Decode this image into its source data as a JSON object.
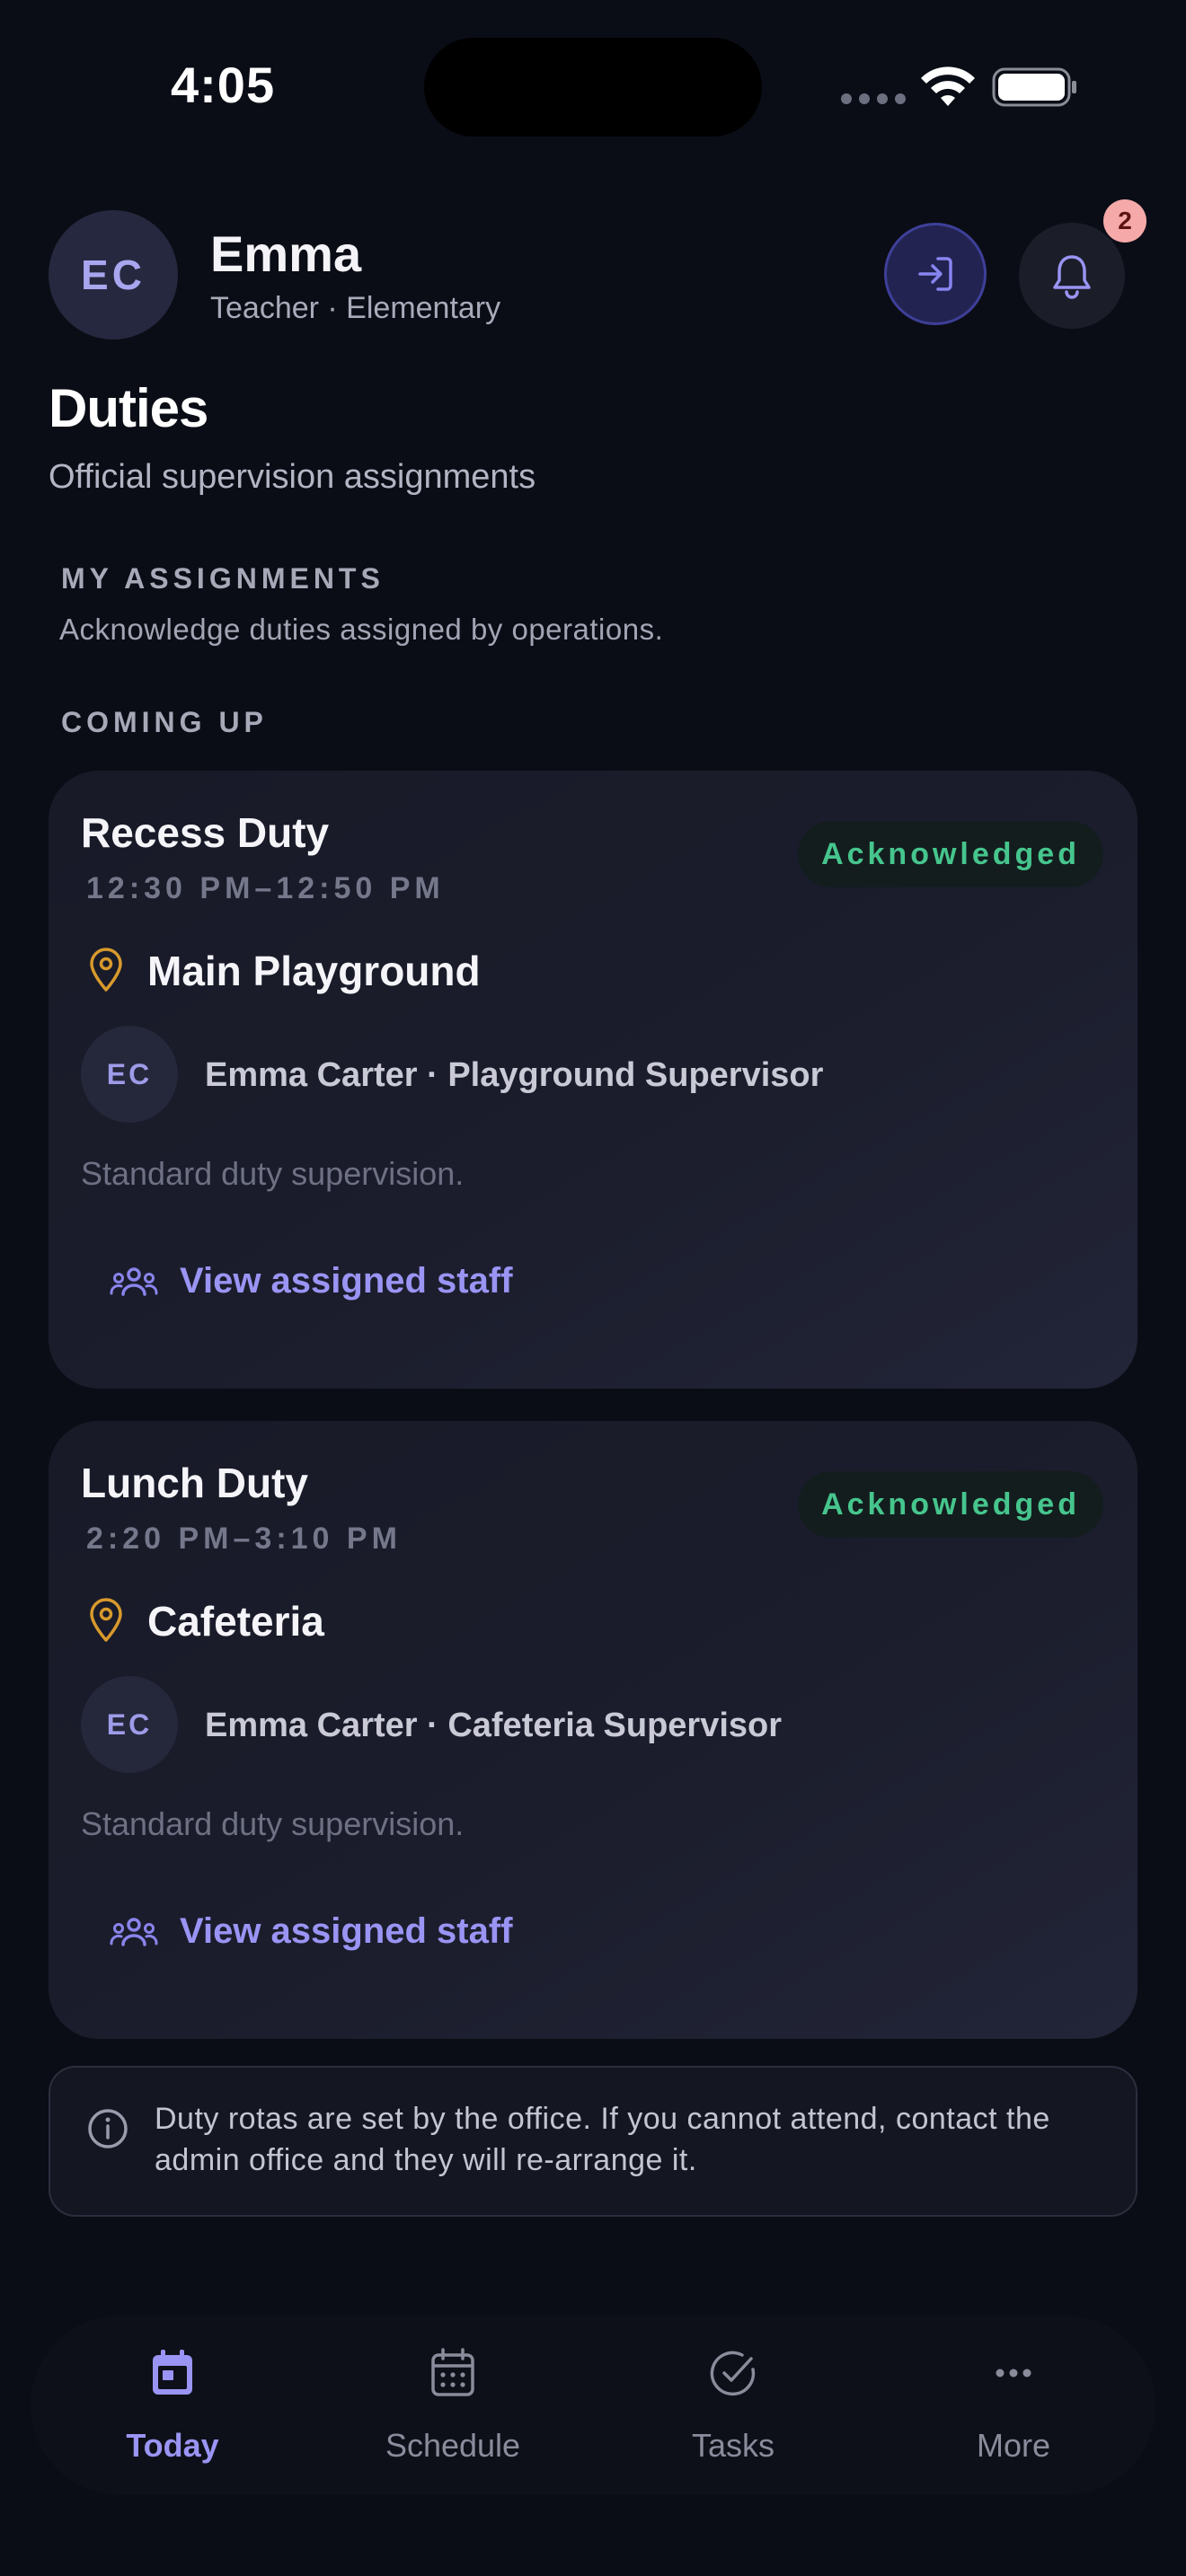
{
  "status_bar": {
    "time": "4:05"
  },
  "header": {
    "avatar_initials": "EC",
    "user_name": "Emma",
    "user_role": "Teacher · Elementary",
    "notification_count": "2"
  },
  "page": {
    "title": "Duties",
    "subtitle": "Official supervision assignments"
  },
  "section": {
    "label": "MY ASSIGNMENTS",
    "description": "Acknowledge duties assigned by operations.",
    "subsection_label": "COMING UP"
  },
  "duties": [
    {
      "title": "Recess Duty",
      "time": "12:30 PM–12:50 PM",
      "status": "Acknowledged",
      "location": "Main Playground",
      "avatar_initials": "EC",
      "staff": "Emma Carter · Playground Supervisor",
      "note": "Standard duty supervision.",
      "action_label": "View assigned staff"
    },
    {
      "title": "Lunch Duty",
      "time": "2:20 PM–3:10 PM",
      "status": "Acknowledged",
      "location": "Cafeteria",
      "avatar_initials": "EC",
      "staff": "Emma Carter · Cafeteria Supervisor",
      "note": "Standard duty supervision.",
      "action_label": "View assigned staff"
    }
  ],
  "info": {
    "text": "Duty rotas are set by the office. If you cannot attend, contact the admin office and they will re-arrange it."
  },
  "nav": {
    "items": [
      {
        "label": "Today",
        "icon": "calendar-day-icon",
        "active": true
      },
      {
        "label": "Schedule",
        "icon": "calendar-grid-icon",
        "active": false
      },
      {
        "label": "Tasks",
        "icon": "check-circle-icon",
        "active": false
      },
      {
        "label": "More",
        "icon": "more-dots-icon",
        "active": false
      }
    ]
  },
  "colors": {
    "background": "#0b0d16",
    "accent": "#9a94f4",
    "success": "#46c58d",
    "badge": "#f6a9a9",
    "pin": "#d89a2c"
  }
}
